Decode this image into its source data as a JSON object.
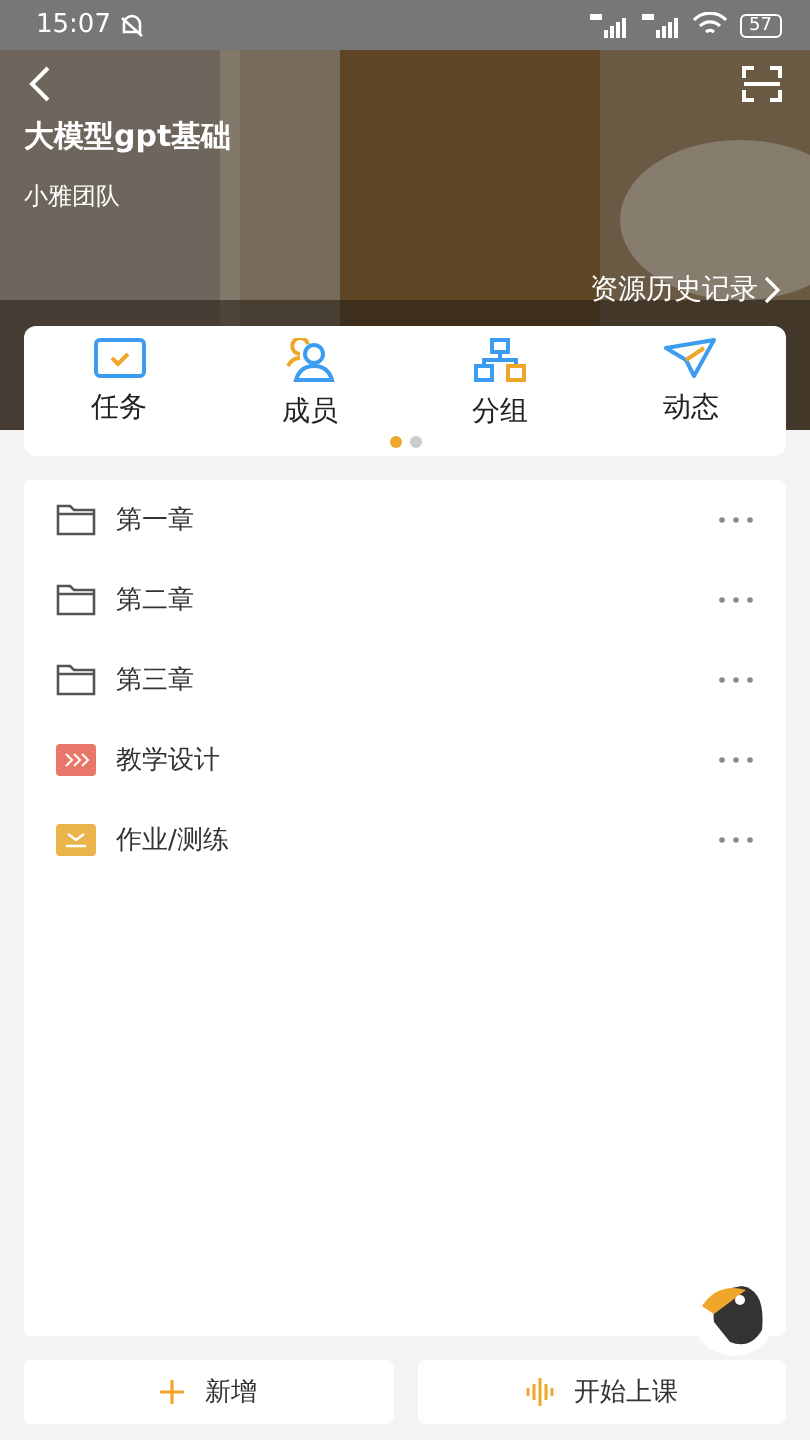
{
  "status_bar": {
    "time": "15:07",
    "battery": "57"
  },
  "header": {
    "title": "大模型gpt基础",
    "team": "小雅团队",
    "history_link": "资源历史记录"
  },
  "tabs": [
    {
      "label": "任务",
      "kind": "task"
    },
    {
      "label": "成员",
      "kind": "members"
    },
    {
      "label": "分组",
      "kind": "groups"
    },
    {
      "label": "动态",
      "kind": "feed"
    }
  ],
  "pager": [
    {
      "selected": true
    },
    {
      "selected": false
    }
  ],
  "resources": [
    {
      "name": "第一章",
      "kind": "folder"
    },
    {
      "name": "第二章",
      "kind": "folder"
    },
    {
      "name": "第三章",
      "kind": "folder"
    },
    {
      "name": "教学设计",
      "kind": "design"
    },
    {
      "name": "作业/测练",
      "kind": "homework"
    }
  ],
  "buttons": [
    {
      "label": "新增",
      "kind": "add"
    },
    {
      "label": "开始上课",
      "kind": "start"
    }
  ]
}
